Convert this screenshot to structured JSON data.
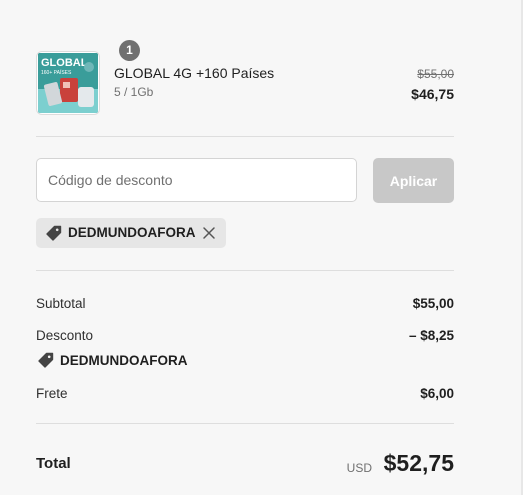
{
  "product": {
    "title": "GLOBAL 4G +160 Países",
    "variant": "5 / 1Gb",
    "quantity": "1",
    "price_original": "$55,00",
    "price_final": "$46,75",
    "thumbnail": {
      "icon": "sim-card-product-image",
      "text_main": "GLOBAL",
      "text_sub": "160+ PAÍSES",
      "colors": [
        "#2f8f8f",
        "#c9413b",
        "#e8f2f2"
      ]
    }
  },
  "discount": {
    "placeholder": "Código de desconto",
    "value": "",
    "apply_label": "Aplicar",
    "applied_code": "DEDMUNDOAFORA"
  },
  "summary": {
    "subtotal_label": "Subtotal",
    "subtotal_value": "$55,00",
    "discount_label": "Desconto",
    "discount_value": "– $8,25",
    "discount_code": "DEDMUNDOAFORA",
    "shipping_label": "Frete",
    "shipping_value": "$6,00",
    "total_label": "Total",
    "total_currency": "USD",
    "total_value": "$52,75"
  },
  "colors": {
    "accent_disabled": "#c8c8c8",
    "chip_bg": "#e6e6e6",
    "muted_text": "#707070"
  }
}
